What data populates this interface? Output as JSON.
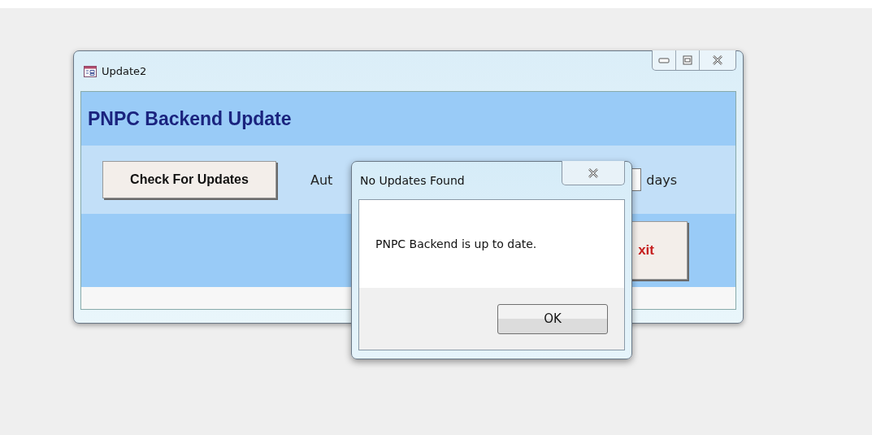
{
  "window": {
    "title": "Update2",
    "header": "PNPC Backend Update",
    "check_button": "Check For Updates",
    "auto_label": "Aut",
    "days_label": "days",
    "exit_button": "xit"
  },
  "dialog": {
    "title": "No Updates Found",
    "message": "PNPC Backend is up to date.",
    "ok_button": "OK"
  }
}
